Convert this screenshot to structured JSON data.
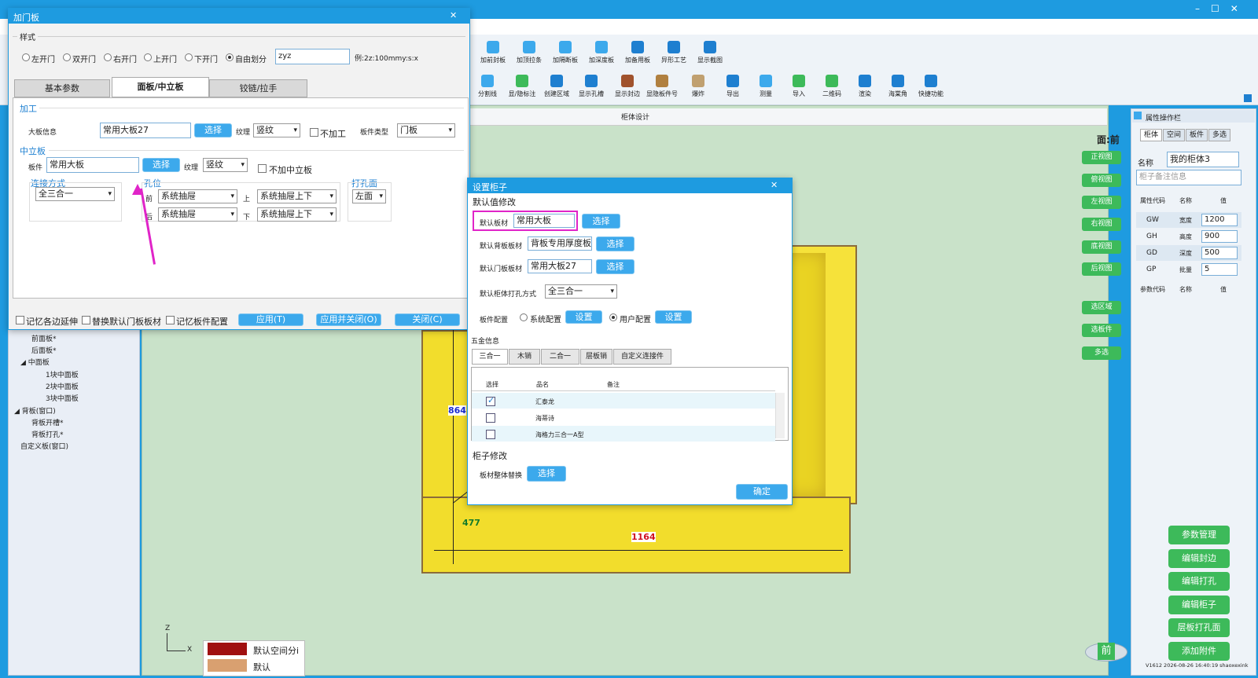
{
  "app": {
    "min": "–",
    "max": "☐",
    "close": "✕"
  },
  "toolbar": {
    "row1": [
      "加前封板",
      "加顶拉条",
      "加隔断板",
      "加深度板",
      "加备用板",
      "异形工艺",
      "显示截图"
    ],
    "row2": [
      "分割线",
      "显/隐标注",
      "创建区域",
      "显示孔槽",
      "显示封边",
      "显隐板件号",
      "爆炸",
      "导出",
      "测量",
      "导入",
      "二维码",
      "渲染",
      "海棠角",
      "快捷功能"
    ]
  },
  "design_tab": "柜体设计",
  "view_face": "面:前",
  "view_buttons": [
    "正视图",
    "俯视图",
    "左视图",
    "右视图",
    "底视图",
    "后视图",
    "选区域",
    "选板件",
    "多选"
  ],
  "viewport": {
    "dim_h": "864",
    "dim_d": "477",
    "dim_w": "1164",
    "nav_label": "前",
    "axis_z": "Z",
    "axis_x": "X",
    "legend": [
      {
        "label": "默认空间分i",
        "color": "#a01010"
      },
      {
        "label": "默认",
        "color": "#d9a070"
      }
    ]
  },
  "tree": {
    "items": [
      "前面板*",
      "后面板*",
      "◢ 中面板",
      "1块中面板",
      "2块中面板",
      "3块中面板",
      "◢ 背板(窗口)",
      "背板开槽*",
      "背板打孔*",
      "自定义板(窗口)"
    ]
  },
  "prop_panel": {
    "title": "属性操作栏",
    "tabs": [
      "柜体",
      "空间",
      "板件",
      "多选"
    ],
    "name_label": "名称",
    "name_value": "我的柜体3",
    "note_placeholder": "柜子备注信息",
    "attr_headers": [
      "属性代码",
      "名称",
      "值"
    ],
    "attrs": [
      {
        "code": "GW",
        "name": "宽度",
        "value": "1200"
      },
      {
        "code": "GH",
        "name": "高度",
        "value": "900"
      },
      {
        "code": "GD",
        "name": "深度",
        "value": "500"
      },
      {
        "code": "GP",
        "name": "批量",
        "value": "5"
      }
    ],
    "param_headers": [
      "参数代码",
      "名称",
      "值"
    ],
    "buttons": [
      "参数管理",
      "编辑封边",
      "编辑打孔",
      "编辑柜子",
      "层板打孔面",
      "添加附件"
    ],
    "version": "V1612 2026-08-26 16:40:19 shaoxexink"
  },
  "door_dialog": {
    "title": "加门板",
    "close": "✕",
    "style_label": "样式",
    "styles": [
      "左开门",
      "双开门",
      "右开门",
      "上开门",
      "下开门",
      "自由划分"
    ],
    "style_input": "zyz",
    "style_hint": "例:2z:100mmy:s:x",
    "tabs": [
      "基本参数",
      "面板/中立板",
      "铰链/拉手"
    ],
    "process_label": "加工",
    "board_info_label": "大板信息",
    "board_info_value": "常用大板27",
    "select": "选择",
    "grain_label": "纹理",
    "grain_value": "竖纹",
    "no_process": "不加工",
    "board_type_label": "板件类型",
    "board_type_value": "门板",
    "mid_label": "中立板",
    "mid_board_label": "板件",
    "mid_board_value": "常用大板",
    "mid_grain_value": "竖纹",
    "no_mid": "不加中立板",
    "conn_label": "连接方式",
    "conn_value": "全三合一",
    "hole_label": "孔位",
    "front_label": "前",
    "back_label": "后",
    "up_label": "上",
    "down_label": "下",
    "hole_front": "系统抽屉",
    "hole_back": "系统抽屉",
    "hole_up": "系统抽屉上下",
    "hole_down": "系统抽屉上下",
    "drill_label": "打孔面",
    "drill_value": "左面",
    "footer_checks": [
      "记忆各边延伸",
      "替换默认门板板材",
      "记忆板件配置"
    ],
    "apply": "应用(T)",
    "apply_close": "应用并关闭(O)",
    "close_btn": "关闭(C)"
  },
  "cab_dialog": {
    "title": "设置柜子",
    "close": "✕",
    "defaults_label": "默认值修改",
    "board_label": "默认板材",
    "board_value": "常用大板",
    "back_label": "默认背板板材",
    "back_value": "背板专用厚度板",
    "door_label": "默认门板板材",
    "door_value": "常用大板27",
    "drill_label": "默认柜体打孔方式",
    "drill_value": "全三合一",
    "select": "选择",
    "config_label": "板件配置",
    "sys_config": "系统配置",
    "user_config": "用户配置",
    "set": "设置",
    "hw_label": "五金信息",
    "hw_tabs": [
      "三合一",
      "木销",
      "二合一",
      "层板销",
      "自定义连接件"
    ],
    "hw_headers": [
      "选择",
      "品名",
      "备注"
    ],
    "hw_rows": [
      {
        "name": "汇泰龙",
        "checked": true
      },
      {
        "name": "海蒂诗",
        "checked": false
      },
      {
        "name": "海格力三合一A型",
        "checked": false
      }
    ],
    "modify_label": "柜子修改",
    "replace_label": "板材整体替换",
    "ok": "确定"
  }
}
